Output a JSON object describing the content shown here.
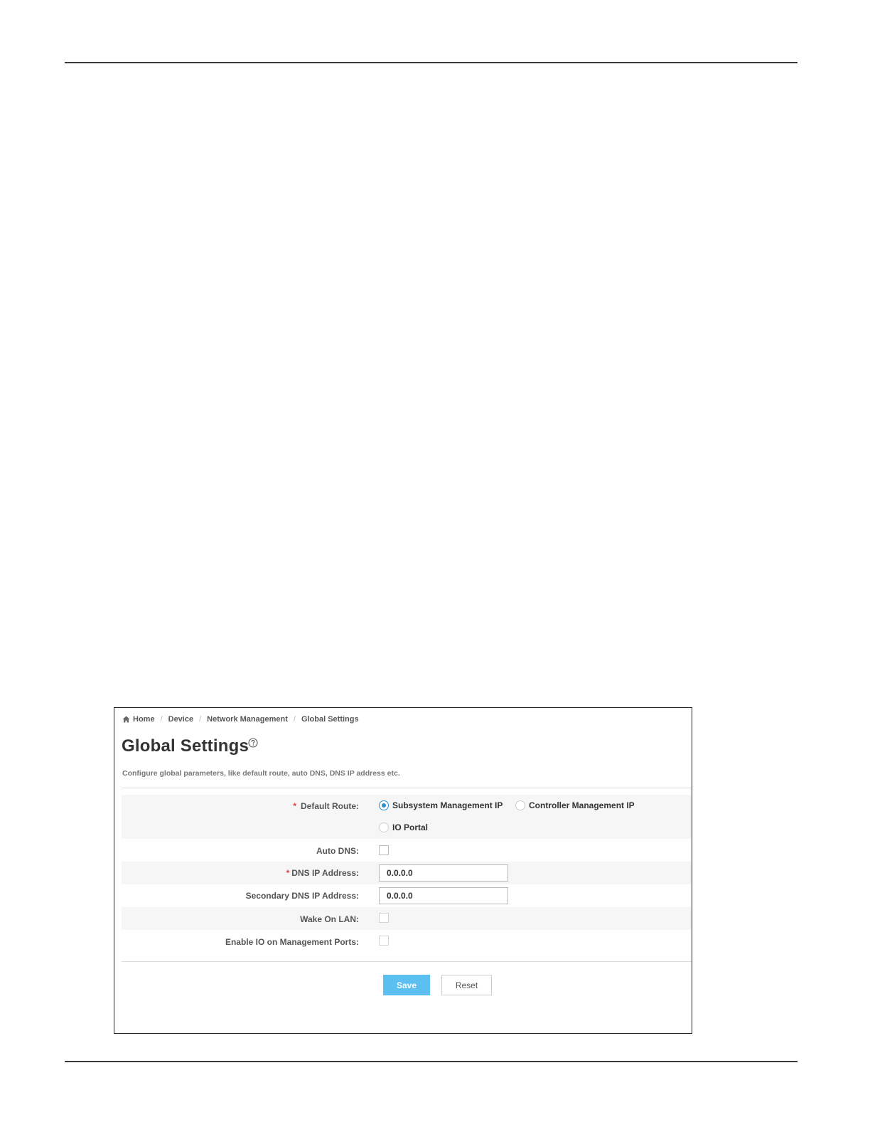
{
  "breadcrumb": {
    "home": "Home",
    "device": "Device",
    "network_management": "Network Management",
    "current": "Global Settings",
    "separator": "/"
  },
  "page": {
    "title": "Global Settings",
    "subtitle": "Configure global parameters, like default route, auto DNS, DNS IP address etc.",
    "help_icon": "question-circle-icon",
    "home_icon": "home-icon"
  },
  "form": {
    "required_mark": "*",
    "default_route": {
      "label": "Default Route:",
      "options": [
        {
          "label": "Subsystem Management IP",
          "selected": true
        },
        {
          "label": "Controller Management IP",
          "selected": false
        },
        {
          "label": "IO Portal",
          "selected": false
        }
      ]
    },
    "auto_dns": {
      "label": "Auto DNS:",
      "checked": false
    },
    "dns_ip": {
      "label": "DNS IP Address:",
      "value": "0.0.0.0"
    },
    "secondary_dns_ip": {
      "label": "Secondary DNS IP Address:",
      "value": "0.0.0.0"
    },
    "wake_on_lan": {
      "label": "Wake On LAN:",
      "checked": false
    },
    "enable_io_mgmt": {
      "label": "Enable IO on Management Ports:",
      "checked": false
    }
  },
  "actions": {
    "save_label": "Save",
    "reset_label": "Reset"
  },
  "colors": {
    "accent": "#2b8fd1",
    "save_button": "#5bc0f0",
    "required": "#e0413a"
  }
}
